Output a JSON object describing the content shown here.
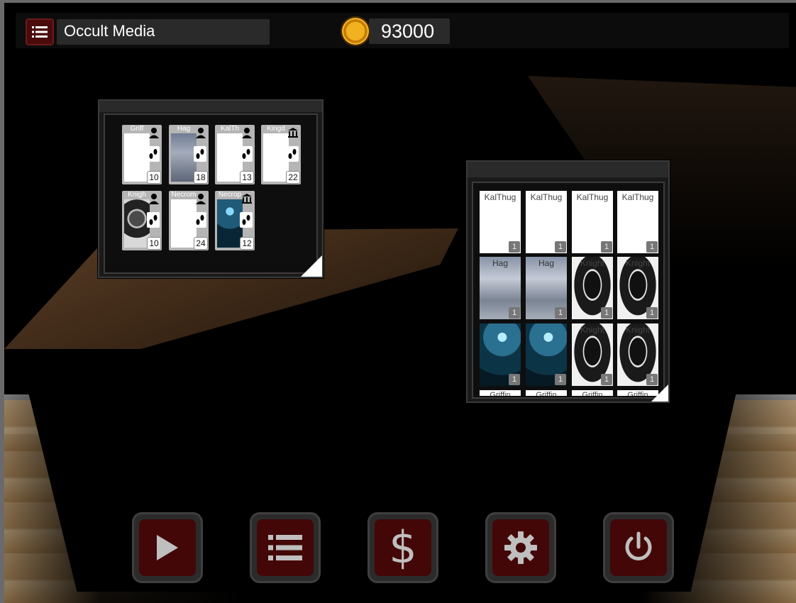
{
  "header": {
    "title": "Occult Media",
    "coins": "93000",
    "colors": {
      "accent": "#430707",
      "coin": "#f1b120"
    }
  },
  "deck_panel": {
    "cards": [
      {
        "name": "Griff",
        "count": "10",
        "type_icon": "person-icon",
        "art": "blank"
      },
      {
        "name": "Hag",
        "count": "18",
        "type_icon": "person-icon",
        "art": "hag"
      },
      {
        "name": "KalTh",
        "count": "13",
        "type_icon": "person-icon",
        "art": "blank"
      },
      {
        "name": "Kingd",
        "count": "22",
        "type_icon": "building-icon",
        "art": "blank"
      },
      {
        "name": "Knigh",
        "count": "10",
        "type_icon": "person-icon",
        "art": "knight"
      },
      {
        "name": "Necrom",
        "count": "24",
        "type_icon": "person-icon",
        "art": "blank"
      },
      {
        "name": "Necrop",
        "count": "12",
        "type_icon": "building-icon",
        "art": "necro"
      }
    ]
  },
  "collection_panel": {
    "cards": [
      {
        "name": "KalThug",
        "count": "1",
        "art": "blank"
      },
      {
        "name": "KalThug",
        "count": "1",
        "art": "blank"
      },
      {
        "name": "KalThug",
        "count": "1",
        "art": "blank"
      },
      {
        "name": "KalThug",
        "count": "1",
        "art": "blank"
      },
      {
        "name": "Hag",
        "count": "1",
        "art": "hag"
      },
      {
        "name": "Hag",
        "count": "1",
        "art": "hag"
      },
      {
        "name": "Knight",
        "count": "1",
        "art": "knight"
      },
      {
        "name": "Knight",
        "count": "1",
        "art": "knight"
      },
      {
        "name": "",
        "count": "1",
        "art": "necro"
      },
      {
        "name": "",
        "count": "1",
        "art": "necro"
      },
      {
        "name": "Knight",
        "count": "1",
        "art": "knight"
      },
      {
        "name": "Knight",
        "count": "1",
        "art": "knight"
      }
    ],
    "peek_row": [
      "Griffin",
      "Griffin",
      "Griffin",
      "Griffin"
    ]
  },
  "toolbar": {
    "buttons": [
      {
        "name": "play-button",
        "icon": "play-icon"
      },
      {
        "name": "list-button",
        "icon": "list-icon"
      },
      {
        "name": "shop-button",
        "icon": "dollar-icon",
        "label": "$"
      },
      {
        "name": "settings-button",
        "icon": "gear-icon"
      },
      {
        "name": "power-button",
        "icon": "power-icon"
      }
    ]
  }
}
